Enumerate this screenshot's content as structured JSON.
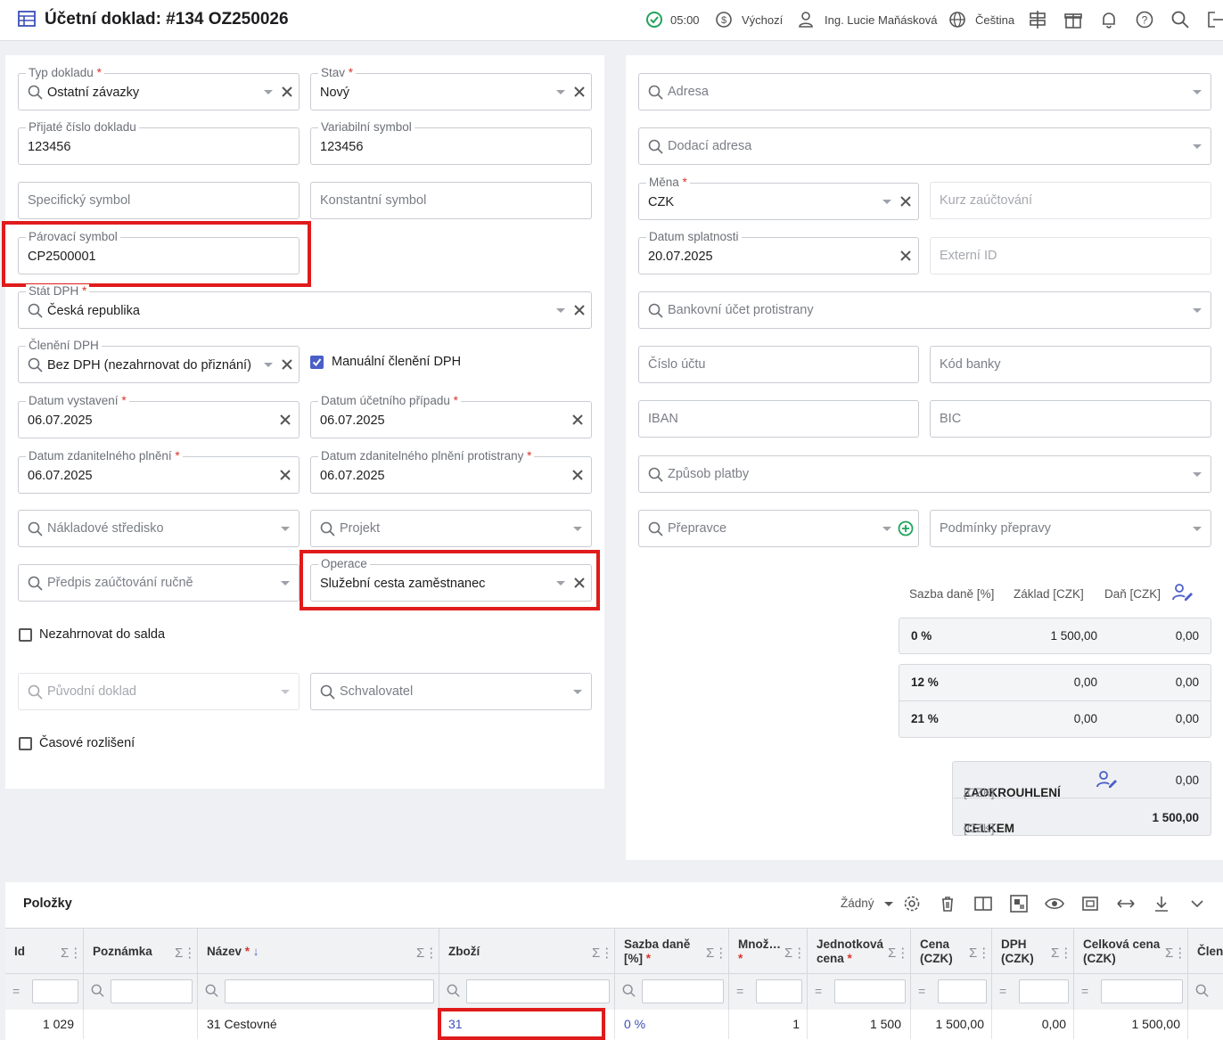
{
  "header": {
    "title": "Účetní doklad: #134 OZ250026",
    "timer": "05:00",
    "default_label": "Výchozí",
    "user": "Ing. Lucie Maňásková",
    "language": "Čeština"
  },
  "left": {
    "typ_dokladu": {
      "label": "Typ dokladu",
      "value": "Ostatní závazky"
    },
    "stav": {
      "label": "Stav",
      "value": "Nový"
    },
    "prijate_cislo": {
      "label": "Přijaté číslo dokladu",
      "value": "123456"
    },
    "variabilni": {
      "label": "Variabilní symbol",
      "value": "123456"
    },
    "specificky": {
      "placeholder": "Specifický symbol"
    },
    "konstantni": {
      "placeholder": "Konstantní symbol"
    },
    "parovaci": {
      "label": "Párovací symbol",
      "value": "CP2500001"
    },
    "stat_dph": {
      "label": "Stát DPH",
      "value": "Česká republika"
    },
    "cleneni_dph": {
      "label": "Členění DPH",
      "value": "Bez DPH (nezahrnovat do přiznání)"
    },
    "manualni_cleneni": {
      "label": "Manuální členění DPH",
      "checked": true
    },
    "datum_vystaveni": {
      "label": "Datum vystavení",
      "value": "06.07.2025"
    },
    "datum_ucetniho": {
      "label": "Datum účetního případu",
      "value": "06.07.2025"
    },
    "datum_zdanitelneho": {
      "label": "Datum zdanitelného plnění",
      "value": "06.07.2025"
    },
    "datum_zdanitelneho_protistrany": {
      "label": "Datum zdanitelného plnění protistrany",
      "value": "06.07.2025"
    },
    "nakladove_stredisko": {
      "placeholder": "Nákladové středisko"
    },
    "projekt": {
      "placeholder": "Projekt"
    },
    "predpis": {
      "placeholder": "Předpis zaúčtování ručně"
    },
    "operace": {
      "label": "Operace",
      "value": "Služební cesta zaměstnanec"
    },
    "nezahrnovat_salda": {
      "label": "Nezahrnovat do salda",
      "checked": false
    },
    "puvodni_doklad": {
      "placeholder": "Původní doklad"
    },
    "schvalovatel": {
      "placeholder": "Schvalovatel"
    },
    "casove_rozliseni": {
      "label": "Časové rozlišení",
      "checked": false
    }
  },
  "right": {
    "adresa": {
      "placeholder": "Adresa"
    },
    "dodaci_adresa": {
      "placeholder": "Dodací adresa"
    },
    "mena": {
      "label": "Měna",
      "value": "CZK"
    },
    "kurz": {
      "placeholder": "Kurz zaúčtování"
    },
    "datum_splatnosti": {
      "label": "Datum splatnosti",
      "value": "20.07.2025"
    },
    "externi_id": {
      "placeholder": "Externí ID"
    },
    "bankovni_ucet": {
      "placeholder": "Bankovní účet protistrany"
    },
    "cislo_uctu": {
      "placeholder": "Číslo účtu"
    },
    "kod_banky": {
      "placeholder": "Kód banky"
    },
    "iban": {
      "placeholder": "IBAN"
    },
    "bic": {
      "placeholder": "BIC"
    },
    "zpusob_platby": {
      "placeholder": "Způsob platby"
    },
    "prepravce": {
      "placeholder": "Přepravce"
    },
    "podminky_prepravy": {
      "placeholder": "Podmínky přepravy"
    }
  },
  "vat": {
    "headers": {
      "rate": "Sazba daně [%]",
      "base": "Základ [CZK]",
      "tax": "Daň [CZK]"
    },
    "rows": [
      {
        "rate": "0 %",
        "base": "1 500,00",
        "tax": "0,00"
      },
      {
        "rate": "12 %",
        "base": "0,00",
        "tax": "0,00"
      },
      {
        "rate": "21 %",
        "base": "0,00",
        "tax": "0,00"
      }
    ],
    "rounding_label": "ZAOKROUHLENÍ",
    "rounding_unit": "[CZK]",
    "rounding_value": "0,00",
    "total_label": "CELKEM",
    "total_unit": "[CZK]",
    "total_value": "1 500,00"
  },
  "items": {
    "title": "Položky",
    "view_select": "Žádný",
    "columns": [
      "Id",
      "Poznámka",
      "Název",
      "Zboží",
      "Sazba daně [%]",
      "Množ…",
      "Jednotková cena",
      "Cena (CZK)",
      "DPH (CZK)",
      "Celková cena (CZK)",
      "Člene"
    ],
    "col_lines": {
      "sazba": [
        "Sazba daně",
        "[%]"
      ],
      "mnoz": [
        "Množ…",
        ""
      ],
      "jedn": [
        "Jednotková",
        "cena"
      ],
      "cena": [
        "Cena",
        "(CZK)"
      ],
      "dph": [
        "DPH",
        "(CZK)"
      ],
      "celk": [
        "Celková cena",
        "(CZK)"
      ]
    },
    "row": {
      "id": "1 029",
      "poznamka": "",
      "nazev": "31 Cestovné",
      "zbozi": "31",
      "sazba": "0 %",
      "mnozstvi": "1",
      "jednotkova": "1 500",
      "cena": "1 500,00",
      "dph": "0,00",
      "celkova": "1 500,00"
    }
  }
}
